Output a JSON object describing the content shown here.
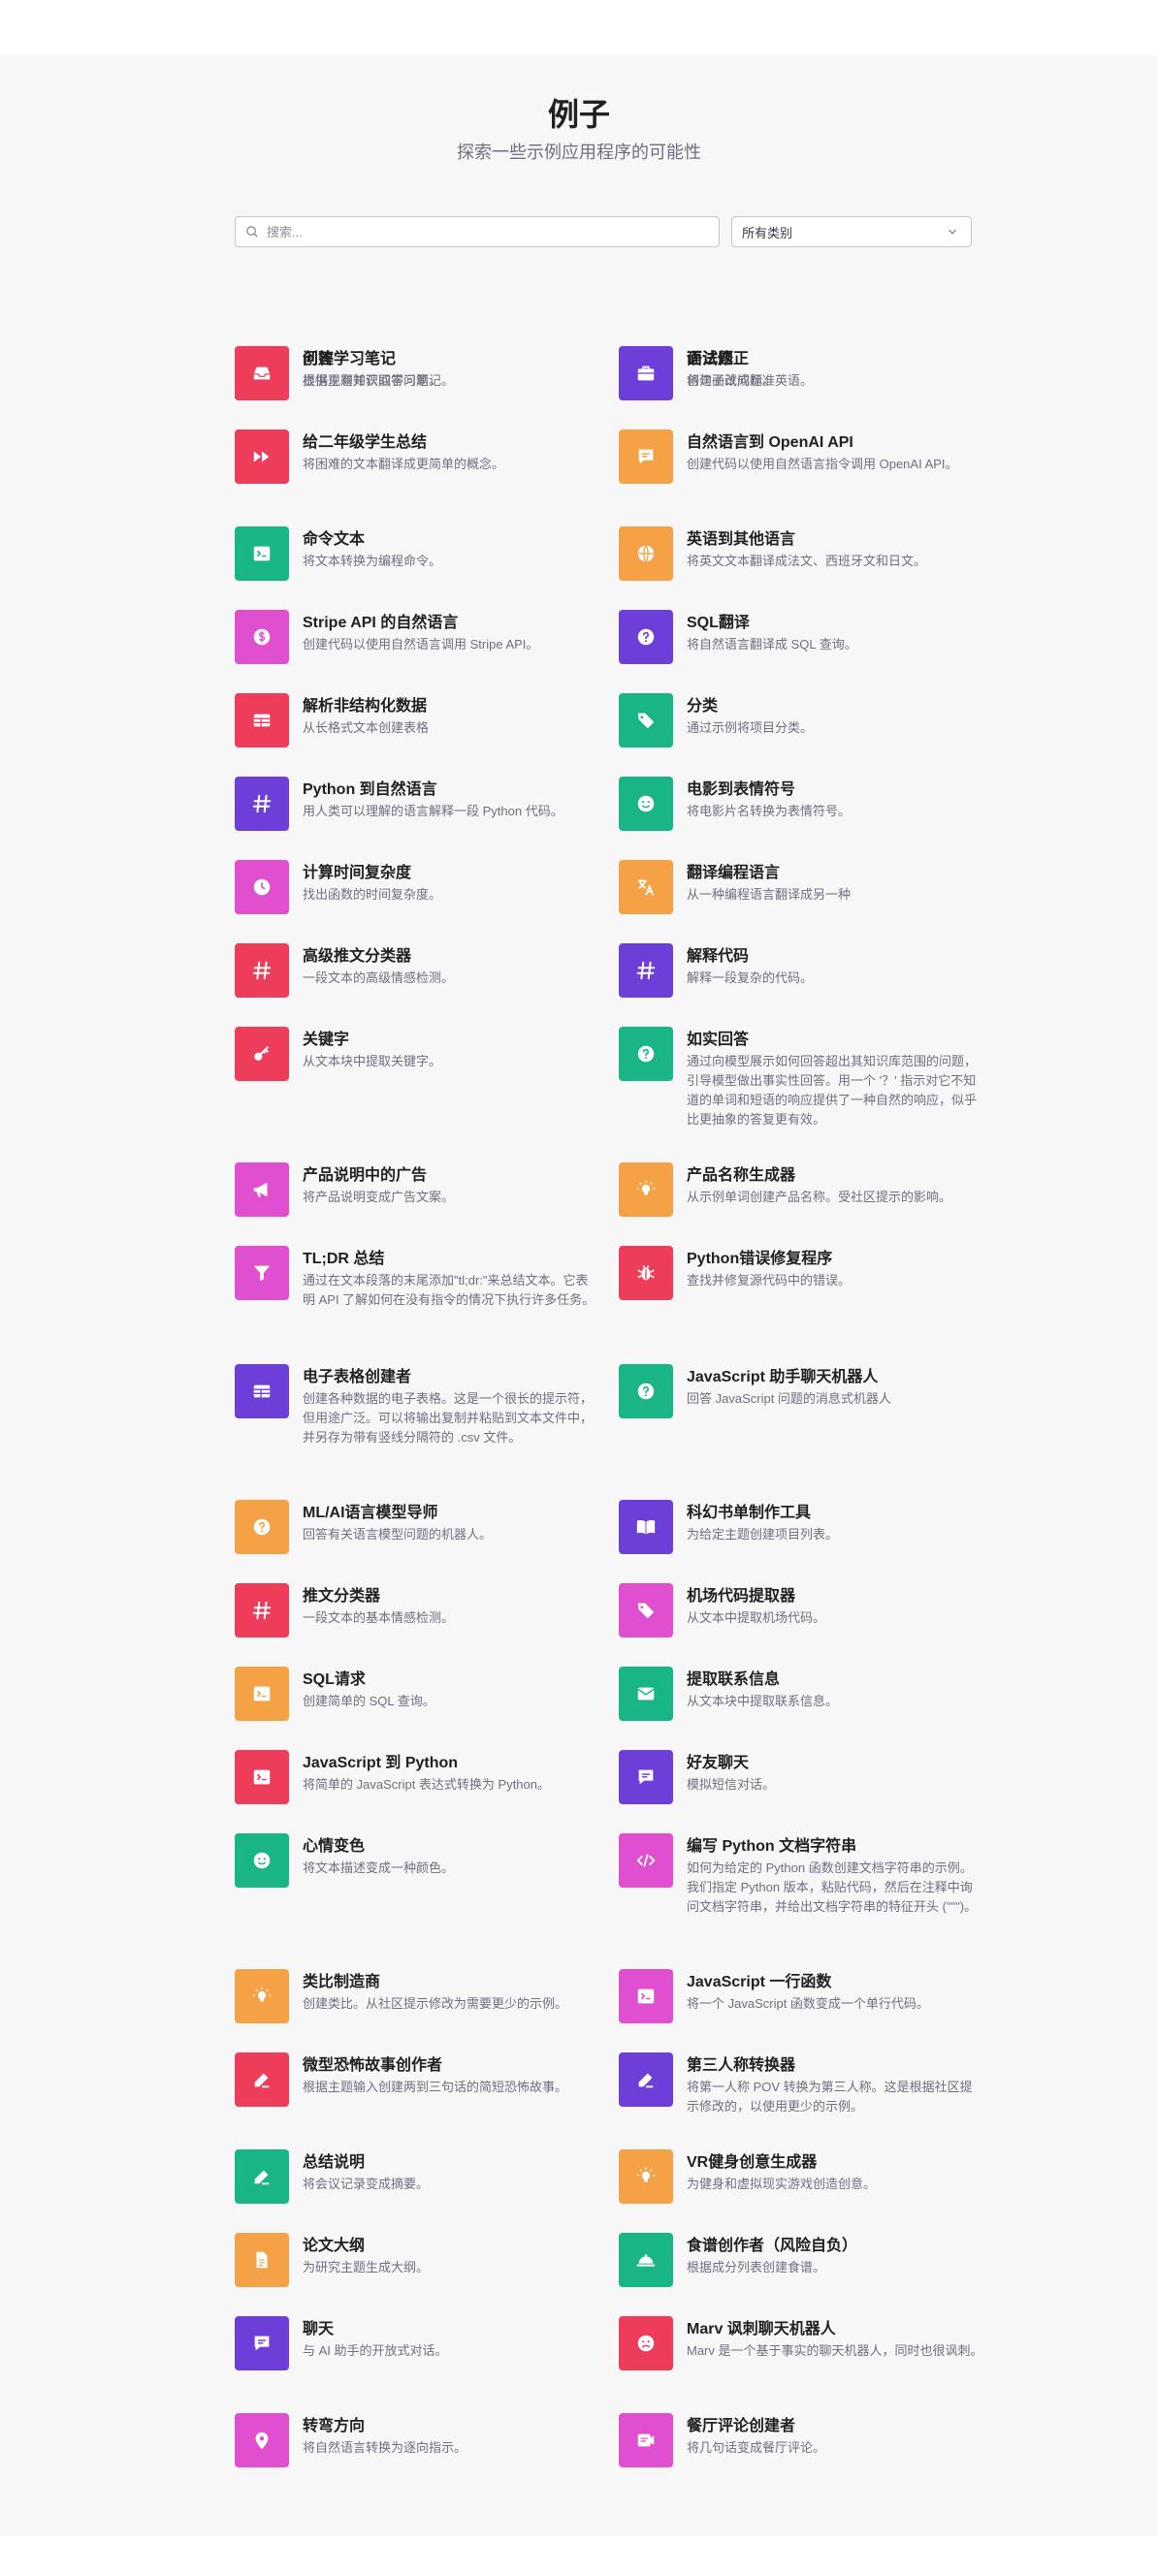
{
  "page": {
    "title": "例子",
    "subtitle": "探索一些示例应用程序的可能性"
  },
  "search": {
    "placeholder": "搜索..."
  },
  "category_select": {
    "value": "所有类别"
  },
  "colors": {
    "purple": "#6e3fd8",
    "pink": "#df4fcf",
    "orange": "#f4a245",
    "green": "#19b586",
    "red": "#ee3c5b"
  },
  "examples": [
    {
      "name": "问答",
      "desc": "根据现有知识回答问题。",
      "color": "#6e3fd8",
      "icon": "question-icon"
    },
    {
      "name": "语法修正",
      "desc": "将句子改成标准英语。",
      "color": "#df4fcf",
      "icon": "graduation-cap-icon"
    },
    {
      "name": "给二年级学生总结",
      "desc": "将困难的文本翻译成更简单的概念。",
      "color": "#ee3c5b",
      "icon": "fast-forward-icon"
    },
    {
      "name": "自然语言到 OpenAI API",
      "desc": "创建代码以使用自然语言指令调用 OpenAI API。",
      "color": "#f4a245",
      "icon": "chat-bubble-icon"
    },
    {
      "name": "命令文本",
      "desc": "将文本转换为编程命令。",
      "color": "#19b586",
      "icon": "terminal-icon"
    },
    {
      "name": "英语到其他语言",
      "desc": "将英文文本翻译成法文、西班牙文和日文。",
      "color": "#f4a245",
      "icon": "globe-icon"
    },
    {
      "name": "Stripe API 的自然语言",
      "desc": "创建代码以使用自然语言调用 Stripe API。",
      "color": "#df4fcf",
      "icon": "dollar-icon"
    },
    {
      "name": "SQL翻译",
      "desc": "将自然语言翻译成 SQL 查询。",
      "color": "#6e3fd8",
      "icon": "question-icon"
    },
    {
      "name": "解析非结构化数据",
      "desc": "从长格式文本创建表格",
      "color": "#ee3c5b",
      "icon": "table-icon"
    },
    {
      "name": "分类",
      "desc": "通过示例将项目分类。",
      "color": "#19b586",
      "icon": "tag-icon"
    },
    {
      "name": "Python 到自然语言",
      "desc": "用人类可以理解的语言解释一段 Python 代码。",
      "color": "#6e3fd8",
      "icon": "hash-icon"
    },
    {
      "name": "电影到表情符号",
      "desc": "将电影片名转换为表情符号。",
      "color": "#19b586",
      "icon": "smiley-icon"
    },
    {
      "name": "计算时间复杂度",
      "desc": "找出函数的时间复杂度。",
      "color": "#df4fcf",
      "icon": "clock-icon"
    },
    {
      "name": "翻译编程语言",
      "desc": "从一种编程语言翻译成另一种",
      "color": "#f4a245",
      "icon": "translate-icon"
    },
    {
      "name": "高级推文分类器",
      "desc": "一段文本的高级情感检测。",
      "color": "#ee3c5b",
      "icon": "hash-icon"
    },
    {
      "name": "解释代码",
      "desc": "解释一段复杂的代码。",
      "color": "#6e3fd8",
      "icon": "hash-icon"
    },
    {
      "name": "关键字",
      "desc": "从文本块中提取关键字。",
      "color": "#ee3c5b",
      "icon": "key-icon"
    },
    {
      "name": "如实回答",
      "desc": "通过向模型展示如何回答超出其知识库范围的问题，引导模型做出事实性回答。用一个 '？' 指示对它不知道的单词和短语的响应提供了一种自然的响应，似乎比更抽象的答复更有效。",
      "color": "#19b586",
      "icon": "question-icon"
    },
    {
      "name": "产品说明中的广告",
      "desc": "将产品说明变成广告文案。",
      "color": "#df4fcf",
      "icon": "megaphone-icon"
    },
    {
      "name": "产品名称生成器",
      "desc": "从示例单词创建产品名称。受社区提示的影响。",
      "color": "#f4a245",
      "icon": "lightbulb-icon"
    },
    {
      "name": "TL;DR 总结",
      "desc": "通过在文本段落的末尾添加\"tl;dr:\"来总结文本。它表明 API 了解如何在没有指令的情况下执行许多任务。",
      "color": "#df4fcf",
      "icon": "filter-icon"
    },
    {
      "name": "Python错误修复程序",
      "desc": "查找并修复源代码中的错误。",
      "color": "#ee3c5b",
      "icon": "bug-icon"
    },
    {
      "name": "电子表格创建者",
      "desc": "创建各种数据的电子表格。这是一个很长的提示符，但用途广泛。可以将输出复制并粘贴到文本文件中，并另存为带有竖线分隔符的 .csv 文件。",
      "color": "#6e3fd8",
      "icon": "table-icon"
    },
    {
      "name": "JavaScript 助手聊天机器人",
      "desc": "回答 JavaScript 问题的消息式机器人",
      "color": "#19b586",
      "icon": "question-icon"
    },
    {
      "name": "ML/AI语言模型导师",
      "desc": "回答有关语言模型问题的机器人。",
      "color": "#f4a245",
      "icon": "question-icon"
    },
    {
      "name": "科幻书单制作工具",
      "desc": "为给定主题创建项目列表。",
      "color": "#6e3fd8",
      "icon": "book-icon"
    },
    {
      "name": "推文分类器",
      "desc": "一段文本的基本情感检测。",
      "color": "#ee3c5b",
      "icon": "hash-icon"
    },
    {
      "name": "机场代码提取器",
      "desc": "从文本中提取机场代码。",
      "color": "#df4fcf",
      "icon": "tag-icon"
    },
    {
      "name": "SQL请求",
      "desc": "创建简单的 SQL 查询。",
      "color": "#f4a245",
      "icon": "terminal-icon"
    },
    {
      "name": "提取联系信息",
      "desc": "从文本块中提取联系信息。",
      "color": "#19b586",
      "icon": "envelope-icon"
    },
    {
      "name": "JavaScript 到 Python",
      "desc": "将简单的 JavaScript 表达式转换为 Python。",
      "color": "#ee3c5b",
      "icon": "terminal-icon"
    },
    {
      "name": "好友聊天",
      "desc": "模拟短信对话。",
      "color": "#6e3fd8",
      "icon": "chat-bubble-icon"
    },
    {
      "name": "心情变色",
      "desc": "将文本描述变成一种颜色。",
      "color": "#19b586",
      "icon": "smiley-icon"
    },
    {
      "name": "编写 Python 文档字符串",
      "desc": "如何为给定的 Python 函数创建文档字符串的示例。我们指定 Python 版本，粘贴代码，然后在注释中询问文档字符串，并给出文档字符串的特征开头 (\"\"\")。",
      "color": "#df4fcf",
      "icon": "code-icon"
    },
    {
      "name": "类比制造商",
      "desc": "创建类比。从社区提示修改为需要更少的示例。",
      "color": "#f4a245",
      "icon": "lightbulb-icon"
    },
    {
      "name": "JavaScript 一行函数",
      "desc": "将一个 JavaScript 函数变成一个单行代码。",
      "color": "#df4fcf",
      "icon": "terminal-icon"
    },
    {
      "name": "微型恐怖故事创作者",
      "desc": "根据主题输入创建两到三句话的简短恐怖故事。",
      "color": "#ee3c5b",
      "icon": "edit-icon"
    },
    {
      "name": "第三人称转换器",
      "desc": "将第一人称 POV 转换为第三人称。这是根据社区提示修改的，以使用更少的示例。",
      "color": "#6e3fd8",
      "icon": "edit-icon"
    },
    {
      "name": "总结说明",
      "desc": "将会议记录变成摘要。",
      "color": "#19b586",
      "icon": "edit-icon"
    },
    {
      "name": "VR健身创意生成器",
      "desc": "为健身和虚拟现实游戏创造创意。",
      "color": "#f4a245",
      "icon": "lightbulb-icon"
    },
    {
      "name": "论文大纲",
      "desc": "为研究主题生成大纲。",
      "color": "#f4a245",
      "icon": "document-icon"
    },
    {
      "name": "食谱创作者（风险自负）",
      "desc": "根据成分列表创建食谱。",
      "color": "#19b586",
      "icon": "dish-icon"
    },
    {
      "name": "聊天",
      "desc": "与 AI 助手的开放式对话。",
      "color": "#6e3fd8",
      "icon": "chat-bubble-icon"
    },
    {
      "name": "Marv 讽刺聊天机器人",
      "desc": "Marv 是一个基于事实的聊天机器人，同时也很讽刺。",
      "color": "#ee3c5b",
      "icon": "frown-icon"
    },
    {
      "name": "转弯方向",
      "desc": "将自然语言转换为逐向指示。",
      "color": "#df4fcf",
      "icon": "map-pin-icon"
    },
    {
      "name": "餐厅评论创建者",
      "desc": "将几句话变成餐厅评论。",
      "color": "#df4fcf",
      "icon": "receipt-icon"
    },
    {
      "name": "创建学习笔记",
      "desc": "提供主题并获取学习笔记。",
      "color": "#ee3c5b",
      "icon": "inbox-icon"
    },
    {
      "name": "面试题",
      "desc": "创建面试问题。",
      "color": "#6e3fd8",
      "icon": "briefcase-icon"
    }
  ]
}
